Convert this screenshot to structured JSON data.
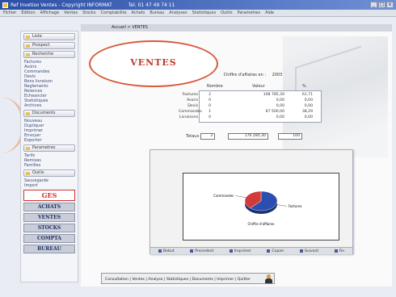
{
  "window": {
    "title": "Ref Invetiso Ventes - Copyright INFORMAT",
    "subtitle": "Tel. 01 47 49 74 11",
    "buttons": [
      "_",
      "□",
      "x"
    ]
  },
  "menu": [
    "Fichier",
    "Edition",
    "Affichage",
    "Ventes",
    "Stocks",
    "Comptabilite",
    "Achats",
    "Bureau",
    "Analyses",
    "Statistiques",
    "Outils",
    "Parametres",
    "Aide"
  ],
  "sidebar": {
    "top_buttons": [
      {
        "label": "Liste"
      },
      {
        "label": "Prospect"
      },
      {
        "label": "Recherche"
      }
    ],
    "links_a": [
      "Factures",
      "Avoirs",
      "Commandes",
      "Devis",
      "Bons livraison",
      "Reglements",
      "Relances",
      "Echeancier",
      "Statistiques",
      "Archives"
    ],
    "section2": {
      "label": "Documents"
    },
    "links_b": [
      "Nouveau",
      "Dupliquer",
      "Imprimer",
      "Envoyer",
      "Exporter"
    ],
    "section3": {
      "label": "Parametres"
    },
    "links_c": [
      "Tarifs",
      "Remises",
      "Familles"
    ],
    "section4": {
      "label": "Outils"
    },
    "links_d": [
      "Sauvegarde",
      "Import"
    ],
    "logo": "GES",
    "big_buttons": [
      "ACHATS",
      "VENTES",
      "STOCKS",
      "COMPTA",
      "BUREAU"
    ]
  },
  "main": {
    "header": "Accueil > VENTES",
    "heading": "VENTES",
    "ca_label": "Chiffre d'affaires en :",
    "ca_value": "2003",
    "columns": [
      "Nombre",
      "Valeur",
      "%"
    ],
    "rows": [
      {
        "label": "Factures",
        "nombre": "2",
        "valeur": "108 785,30",
        "pct": "61,71"
      },
      {
        "label": "Avoirs",
        "nombre": "0",
        "valeur": "0,00",
        "pct": "0,00"
      },
      {
        "label": "Devis",
        "nombre": "0",
        "valeur": "0,00",
        "pct": "0,00"
      },
      {
        "label": "Commandes",
        "nombre": "1",
        "valeur": "67 500,00",
        "pct": "38,29"
      },
      {
        "label": "Livraisons",
        "nombre": "0",
        "valeur": "0,00",
        "pct": "0,00"
      }
    ],
    "totaux": {
      "label": "Totaux",
      "nombre": "3",
      "valeur": "176 285,30",
      "pct": "100"
    }
  },
  "chart_data": {
    "type": "pie",
    "labels": [
      "Factures",
      "Commandes"
    ],
    "values": [
      61.71,
      38.29
    ],
    "colors": [
      "#2a4fb0",
      "#d23a3a"
    ],
    "slice_labels": [
      "Factures",
      "Commandes"
    ],
    "caption": "Chiffre d'affaires",
    "title": ""
  },
  "chart_nav": [
    "Debut",
    "Precedent",
    "Imprimer",
    "Copier",
    "Suivant",
    "Fin"
  ],
  "footer": {
    "text": "Consultation | Ventes | Analyse | Statistiques | Documents | Imprimer | Quitter"
  }
}
